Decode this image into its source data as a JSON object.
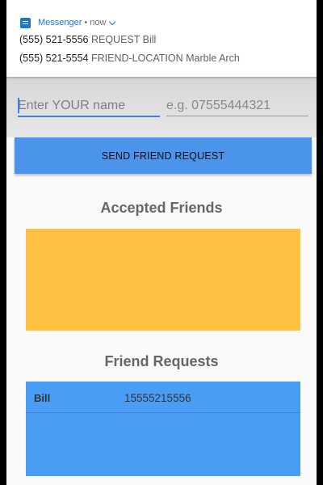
{
  "notification": {
    "app_name": "Messenger",
    "separator": "•",
    "time": "now",
    "lines": [
      {
        "number": "(555) 521-5556",
        "message": "REQUEST Bill"
      },
      {
        "number": "(555) 521-5554",
        "message": "FRIEND-LOCATION Marble Arch"
      }
    ]
  },
  "form": {
    "name_placeholder": "Enter YOUR name",
    "phone_placeholder": "e.g. 07555444321",
    "send_label": "SEND FRIEND REQUEST"
  },
  "accepted": {
    "title": "Accepted Friends",
    "color": "#ffc13f",
    "items": []
  },
  "requests": {
    "title": "Friend Requests",
    "color": "#4a9df5",
    "items": [
      {
        "name": "Bill",
        "number": "15555215556"
      }
    ]
  },
  "colors": {
    "accent": "#4a94ec",
    "notification_app": "#1976d2"
  },
  "icons": {
    "notification_icon": "messenger-app-icon",
    "expand_icon": "chevron-down-icon"
  }
}
